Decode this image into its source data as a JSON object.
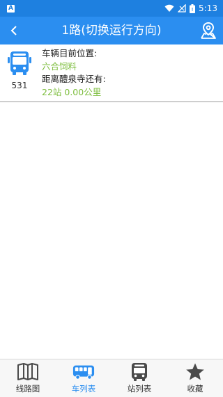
{
  "status_bar": {
    "notification_icon": "A",
    "time": "5:13"
  },
  "header": {
    "title": "1路(切换运行方向)",
    "back_icon": "chevron-left-icon",
    "map_icon": "map-pin-icon"
  },
  "vehicles": [
    {
      "bus_number": "531",
      "position_label": "车辆目前位置:",
      "position_value": "六合饲料",
      "distance_label": "距离醴泉寺还有:",
      "distance_value": "22站  0.00公里"
    }
  ],
  "tabs": [
    {
      "label": "线路图",
      "icon": "map-book-icon",
      "active": false
    },
    {
      "label": "车列表",
      "icon": "bus-side-icon",
      "active": true
    },
    {
      "label": "站列表",
      "icon": "bus-front-icon",
      "active": false
    },
    {
      "label": "收藏",
      "icon": "star-icon",
      "active": false
    }
  ],
  "colors": {
    "primary": "#2b8ef0",
    "status_bar": "#1e80e0",
    "highlight_text": "#7cbd3c",
    "tab_inactive_icon": "#4a4a4a"
  }
}
